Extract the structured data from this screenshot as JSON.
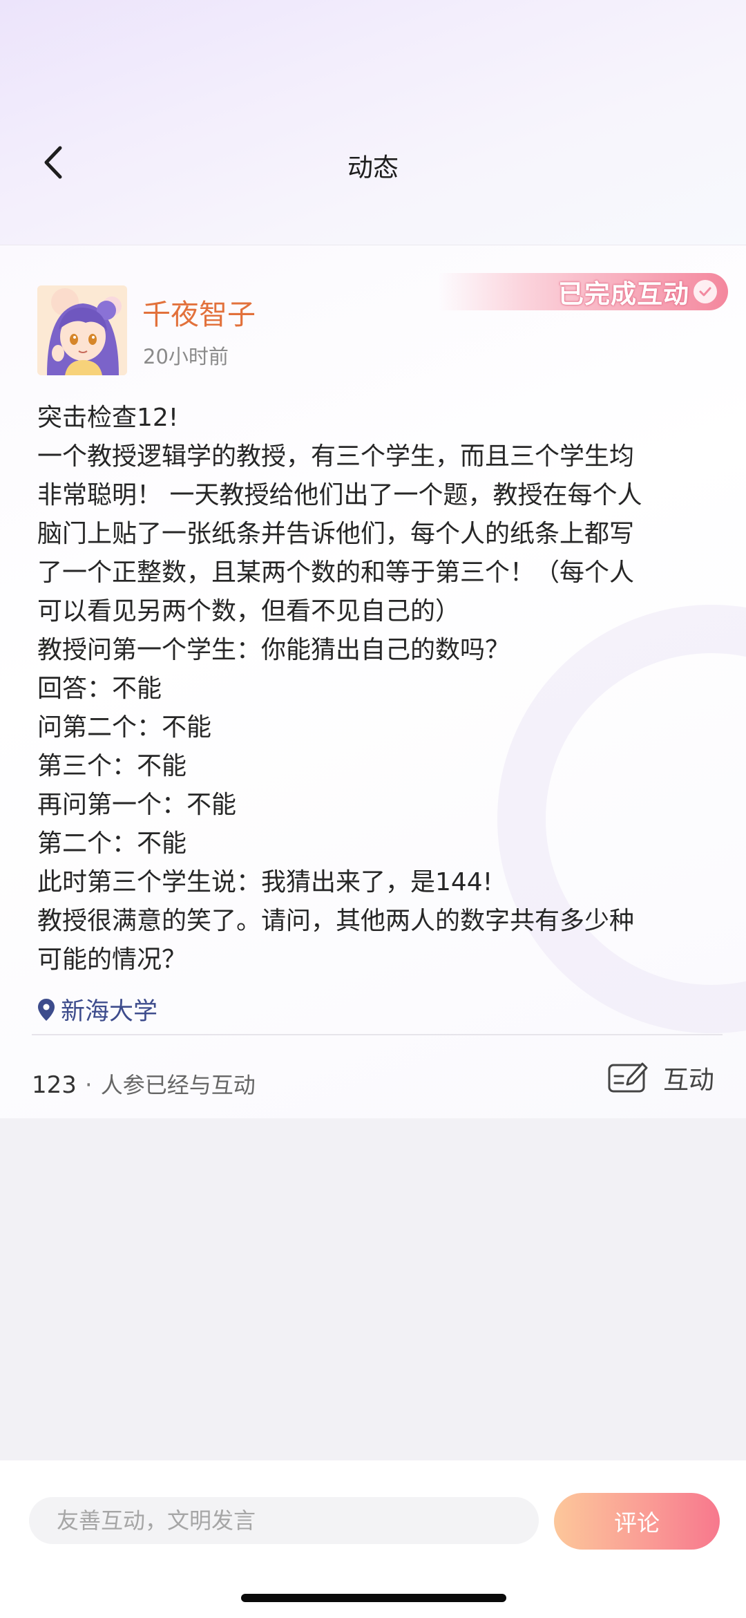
{
  "nav": {
    "title": "动态"
  },
  "post": {
    "username": "千夜智子",
    "time": "20小时前",
    "badge": "已完成互动",
    "lines": [
      "突击检查12!",
      "一个教授逻辑学的教授，有三个学生，而且三个学生均",
      "非常聪明！ 一天教授给他们出了一个题，教授在每个人",
      "脑门上贴了一张纸条并告诉他们，每个人的纸条上都写",
      "了一个正整数，且某两个数的和等于第三个！（每个人",
      "可以看见另两个数，但看不见自己的）",
      "教授问第一个学生：你能猜出自己的数吗？",
      "回答：不能",
      "问第二个：不能",
      "第三个：不能",
      "再问第一个：不能",
      "第二个：不能",
      "此时第三个学生说：我猜出来了，是144!",
      "教授很满意的笑了。请问，其他两人的数字共有多少种",
      "可能的情况？"
    ],
    "location": "新海大学",
    "interaction_count": "123",
    "interaction_dot": "·",
    "interaction_label": "人参已经与互动",
    "interact_button": "互动"
  },
  "comment_bar": {
    "placeholder": "友善互动，文明发言",
    "submit_label": "评论"
  },
  "colors": {
    "username": "#e2713b",
    "location": "#3d4c8c",
    "badge_gradient_end": "#f4879d",
    "comment_button_start": "#fcc79a",
    "comment_button_end": "#f7788d"
  },
  "icons": {
    "back": "chevron-left-icon",
    "badge_check": "check-circle-icon",
    "location": "location-pin-icon",
    "interact": "edit-card-icon"
  }
}
